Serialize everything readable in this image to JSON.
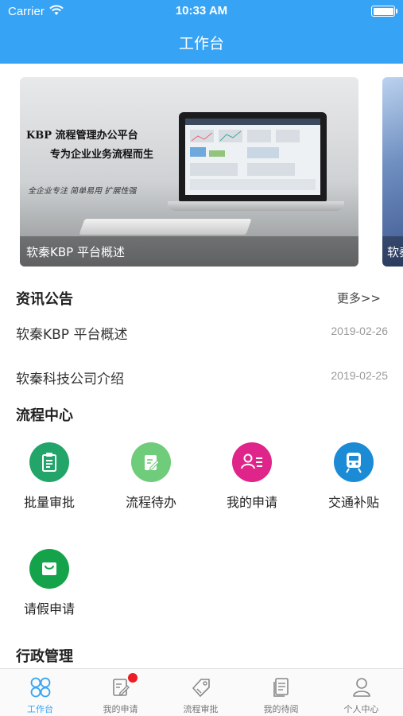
{
  "status_bar": {
    "carrier": "Carrier",
    "time": "10:33 AM"
  },
  "header": {
    "title": "工作台"
  },
  "banner": {
    "caption": "软秦KBP 平台概述",
    "line1": "KBP 流程管理办公平台",
    "line2": "专为企业业务流程而生",
    "line3": "全企业专注 简单易用 扩展性强",
    "peek_caption": "软秦"
  },
  "news": {
    "section_title": "资讯公告",
    "more_label": "更多>>",
    "items": [
      {
        "title": "软秦KBP 平台概述",
        "date": "2019-02-26"
      },
      {
        "title": "软秦科技公司介绍",
        "date": "2019-02-25"
      }
    ]
  },
  "process": {
    "section_title": "流程中心",
    "items": [
      {
        "label": "批量审批",
        "icon": "clipboard-icon",
        "color": "#23a56a"
      },
      {
        "label": "流程待办",
        "icon": "edit-note-icon",
        "color": "#6fcc7b"
      },
      {
        "label": "我的申请",
        "icon": "user-list-icon",
        "color": "#e0258a"
      },
      {
        "label": "交通补贴",
        "icon": "train-icon",
        "color": "#1b8bd6"
      },
      {
        "label": "请假申请",
        "icon": "bag-icon",
        "color": "#14a34a"
      }
    ]
  },
  "admin": {
    "section_title": "行政管理"
  },
  "tabbar": {
    "items": [
      {
        "label": "工作台",
        "icon": "grid-icon",
        "active": true
      },
      {
        "label": "我的申请",
        "icon": "edit-icon",
        "badge": true
      },
      {
        "label": "流程审批",
        "icon": "tag-icon"
      },
      {
        "label": "我的待阅",
        "icon": "document-icon"
      },
      {
        "label": "个人中心",
        "icon": "person-icon"
      }
    ]
  },
  "colors": {
    "primary": "#37a3f5"
  }
}
